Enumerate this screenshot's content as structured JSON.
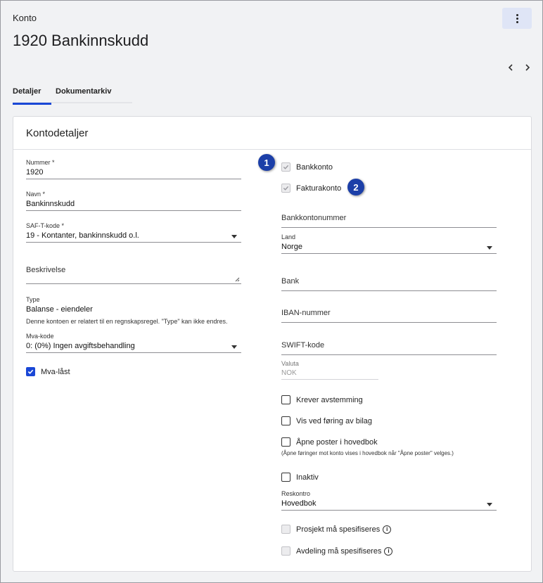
{
  "header": {
    "crumb": "Konto",
    "title": "1920 Bankinnskudd"
  },
  "tabs": [
    {
      "label": "Detaljer",
      "active": true
    },
    {
      "label": "Dokumentarkiv",
      "active": false
    }
  ],
  "card": {
    "title": "Kontodetaljer"
  },
  "left": {
    "nummer": {
      "label": "Nummer *",
      "value": "1920"
    },
    "navn": {
      "label": "Navn *",
      "value": "Bankinnskudd"
    },
    "saft": {
      "label": "SAF-T-kode *",
      "value": "19 - Kontanter, bankinnskudd o.l."
    },
    "beskrivelse": {
      "placeholder": "Beskrivelse"
    },
    "type": {
      "label": "Type",
      "value": "Balanse - eiendeler",
      "note": "Denne kontoen er relatert til en regnskapsregel. \"Type\" kan ikke endres."
    },
    "mva": {
      "label": "Mva-kode",
      "value": "0: (0%) Ingen avgiftsbehandling"
    },
    "mva_last": {
      "label": "Mva-låst",
      "checked": true
    }
  },
  "right": {
    "bankkonto": {
      "label": "Bankkonto",
      "checked": true
    },
    "fakturakonto": {
      "label": "Fakturakonto",
      "checked": true
    },
    "bankkontonummer": {
      "placeholder": "Bankkontonummer"
    },
    "land": {
      "label": "Land",
      "value": "Norge"
    },
    "bank": {
      "placeholder": "Bank"
    },
    "iban": {
      "placeholder": "IBAN-nummer"
    },
    "swift": {
      "placeholder": "SWIFT-kode"
    },
    "valuta": {
      "label": "Valuta",
      "value": "NOK"
    },
    "krever": {
      "label": "Krever avstemming"
    },
    "vis": {
      "label": "Vis ved føring av bilag"
    },
    "apne": {
      "label": "Åpne poster i hovedbok",
      "note": "(Åpne føringer mot konto vises i hovedbok når \"Åpne poster\" velges.)"
    },
    "inaktiv": {
      "label": "Inaktiv"
    },
    "reskontro": {
      "label": "Reskontro",
      "value": "Hovedbok"
    },
    "prosjekt": {
      "label": "Prosjekt må spesifiseres"
    },
    "avdeling": {
      "label": "Avdeling må spesifiseres"
    }
  },
  "badges": {
    "one": "1",
    "two": "2"
  },
  "icons": {
    "info": "i"
  }
}
